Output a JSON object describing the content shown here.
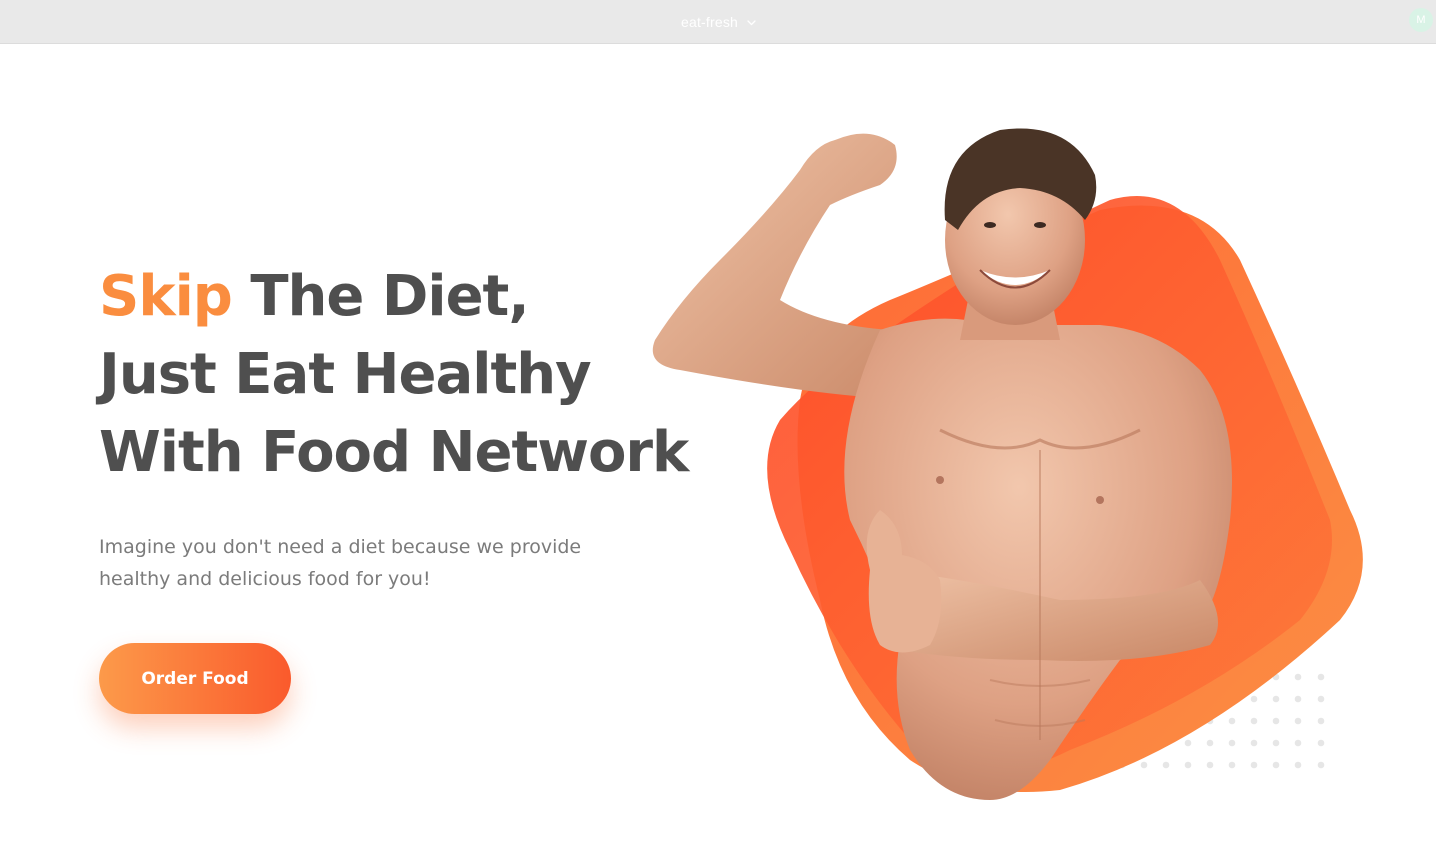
{
  "topbar": {
    "project_name": "eat-fresh",
    "avatar_initial": "M"
  },
  "hero": {
    "headline_accent": "Skip",
    "headline_rest": " The Diet,",
    "headline_line2": "Just Eat Healthy",
    "headline_line3": "With Food Network",
    "subtitle_line1": "Imagine you don't need a diet because we provide",
    "subtitle_line2": "healthy and delicious food for you!",
    "cta_label": "Order Food"
  },
  "colors": {
    "accent": "#fa8d3f",
    "heading": "#4f4f4f",
    "body_text": "#7b7b7b",
    "blob_orange": "#fc7a3a",
    "blob_red": "#ff4f2a",
    "topbar": "#e9e9e9"
  },
  "icons": {
    "project_dropdown": "chevron-down-icon"
  }
}
